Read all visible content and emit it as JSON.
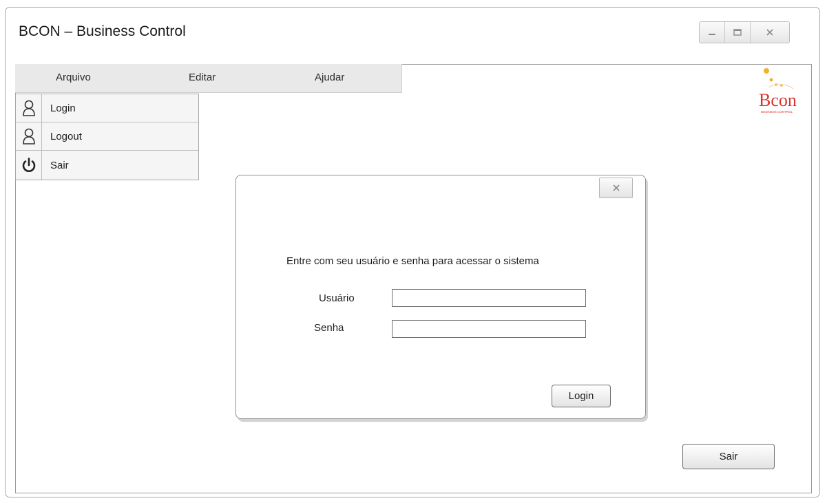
{
  "window": {
    "title": "BCON – Business Control",
    "controls": {
      "minimize_icon": "minimize-icon",
      "maximize_icon": "maximize-icon",
      "close_icon": "close-icon"
    }
  },
  "menubar": {
    "items": [
      {
        "label": "Arquivo"
      },
      {
        "label": "Editar"
      },
      {
        "label": "Ajudar"
      }
    ]
  },
  "dropdown": {
    "items": [
      {
        "label": "Login",
        "icon": "user-icon"
      },
      {
        "label": "Logout",
        "icon": "user-icon"
      },
      {
        "label": "Sair",
        "icon": "power-icon"
      }
    ]
  },
  "logo": {
    "text": "Bcon",
    "tagline": "BUSINESS CONTROL",
    "accent_color": "#d9342b",
    "dot_color": "#f2b02e"
  },
  "dialog": {
    "message": "Entre com seu usuário e senha para acessar o sistema",
    "user_label": "Usuário",
    "user_value": "",
    "password_label": "Senha",
    "password_value": "",
    "login_button": "Login",
    "close_icon": "close-icon"
  },
  "footer": {
    "exit_button": "Sair"
  }
}
